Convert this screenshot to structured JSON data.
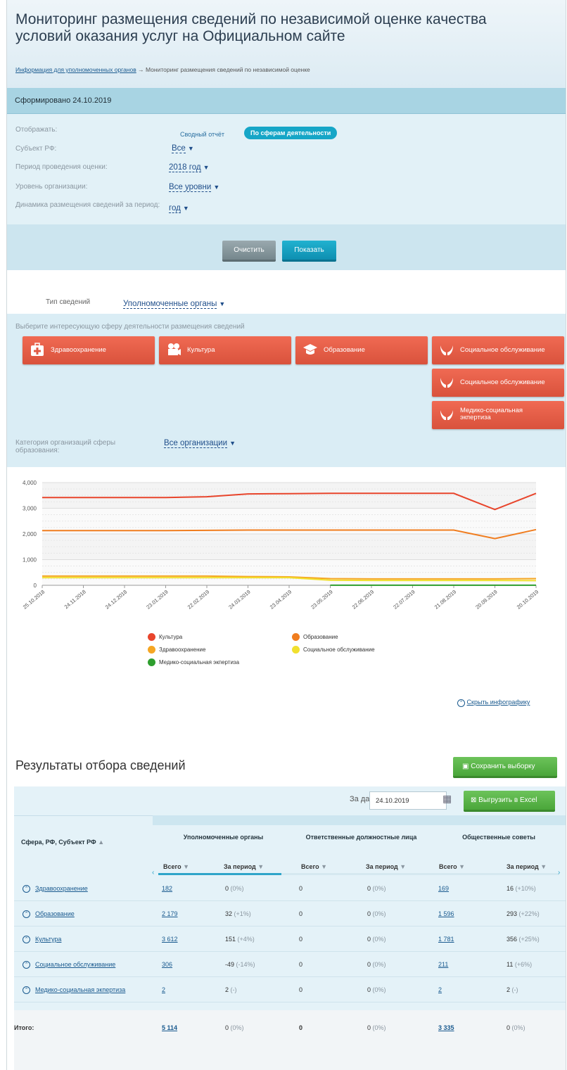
{
  "header": {
    "title": "Мониторинг размещения сведений по независимой оценке качества условий оказания услуг на Официальном сайте",
    "breadcrumb_link": "Информация для уполномоченных органов",
    "breadcrumb_arrow": "→",
    "breadcrumb_current": "Мониторинг размещения сведений по независимой оценке"
  },
  "generated": "Сформировано 24.10.2019",
  "filters": {
    "display_label": "Отображать:",
    "display_options": [
      "Сводный отчёт",
      "По сферам деятельности"
    ],
    "subject_label": "Субъект РФ:",
    "subject_value": "Все",
    "period_label": "Период проведения оценки:",
    "period_value": "2018 год",
    "level_label": "Уровень организации:",
    "level_value": "Все уровни",
    "dynamics_label": "Динамика размещения сведений за период:",
    "dynamics_value": "год",
    "clear_button": "Очистить",
    "show_button": "Показать"
  },
  "info_type": {
    "label": "Тип сведений",
    "value": "Уполномоченные органы"
  },
  "spheres": {
    "prompt": "Выберите интересующую сферу деятельности размещения сведений",
    "cards": [
      "Здравоохранение",
      "Культура",
      "Образование",
      "Социальное обслуживание",
      "Социальное обслуживание",
      "Медико-социальная экпертиза"
    ],
    "category_label": "Категория организаций сферы образования:",
    "category_value": "Все организации"
  },
  "chart_data": {
    "type": "line",
    "x": [
      "25.10.2018",
      "24.11.2018",
      "24.12.2018",
      "23.01.2019",
      "22.02.2019",
      "24.03.2019",
      "23.04.2019",
      "23.05.2019",
      "22.06.2019",
      "22.07.2019",
      "21.08.2019",
      "20.09.2019",
      "20.10.2019"
    ],
    "ylim": [
      0,
      4000
    ],
    "yticks": [
      "0",
      "1,000",
      "2,000",
      "3,000",
      "4,000"
    ],
    "series": [
      {
        "name": "Культура",
        "color": "#e8452c",
        "values": [
          3420,
          3420,
          3420,
          3420,
          3450,
          3560,
          3570,
          3580,
          3580,
          3580,
          3580,
          2950,
          3580
        ]
      },
      {
        "name": "Образование",
        "color": "#f07d1f",
        "values": [
          2130,
          2130,
          2130,
          2130,
          2140,
          2150,
          2150,
          2150,
          2150,
          2150,
          2150,
          1820,
          2170
        ]
      },
      {
        "name": "Здравоохранение",
        "color": "#f5a623",
        "values": [
          360,
          360,
          360,
          360,
          360,
          340,
          330,
          260,
          250,
          250,
          250,
          250,
          260
        ]
      },
      {
        "name": "Социальное обслуживание",
        "color": "#f1e02e",
        "values": [
          300,
          300,
          300,
          300,
          300,
          300,
          300,
          200,
          190,
          190,
          190,
          190,
          180
        ]
      },
      {
        "name": "Медико-социальная экпертиза",
        "color": "#2e9e2e",
        "values": [
          null,
          null,
          null,
          null,
          null,
          null,
          null,
          2,
          2,
          2,
          2,
          2,
          2
        ]
      }
    ],
    "legend": "bottom",
    "grid": true
  },
  "hide_infographic": "Скрыть инфографику",
  "results": {
    "title": "Результаты отбора сведений",
    "save_button": "Сохранить выборку",
    "date_label": "За дату:",
    "date_value": "24.10.2019",
    "excel_button": "Выгрузить в Excel",
    "col_sphere": "Сфера, РФ, Субъект РФ",
    "groups": [
      "Уполномоченные органы",
      "Ответственные должностные лица",
      "Общественные советы"
    ],
    "sub_total": "Всего",
    "sub_period": "За период",
    "rows": [
      {
        "name": "Здравоохранение",
        "c1": "182",
        "c2": "0",
        "c2p": "(0%)",
        "c3": "0",
        "c4": "0",
        "c4p": "(0%)",
        "c5": "169",
        "c6": "16",
        "c6p": "(+10%)"
      },
      {
        "name": "Образование",
        "c1": "2 179",
        "c2": "32",
        "c2p": "(+1%)",
        "c3": "0",
        "c4": "0",
        "c4p": "(0%)",
        "c5": "1 596",
        "c6": "293",
        "c6p": "(+22%)"
      },
      {
        "name": "Культура",
        "c1": "3 612",
        "c2": "151",
        "c2p": "(+4%)",
        "c3": "0",
        "c4": "0",
        "c4p": "(0%)",
        "c5": "1 781",
        "c6": "356",
        "c6p": "(+25%)"
      },
      {
        "name": "Социальное обслуживание",
        "c1": "306",
        "c2": "-49",
        "c2p": "(-14%)",
        "c3": "0",
        "c4": "0",
        "c4p": "(0%)",
        "c5": "211",
        "c6": "11",
        "c6p": "(+6%)"
      },
      {
        "name": "Медико-социальная экпертиза",
        "c1": "2",
        "c2": "2",
        "c2p": "(-)",
        "c3": "0",
        "c4": "0",
        "c4p": "(0%)",
        "c5": "2",
        "c6": "2",
        "c6p": "(-)"
      }
    ],
    "total": {
      "name": "Итого:",
      "c1": "5 114",
      "c2": "0",
      "c2p": "(0%)",
      "c3": "0",
      "c4": "0",
      "c4p": "(0%)",
      "c5": "3 335",
      "c6": "0",
      "c6p": "(0%)"
    }
  }
}
